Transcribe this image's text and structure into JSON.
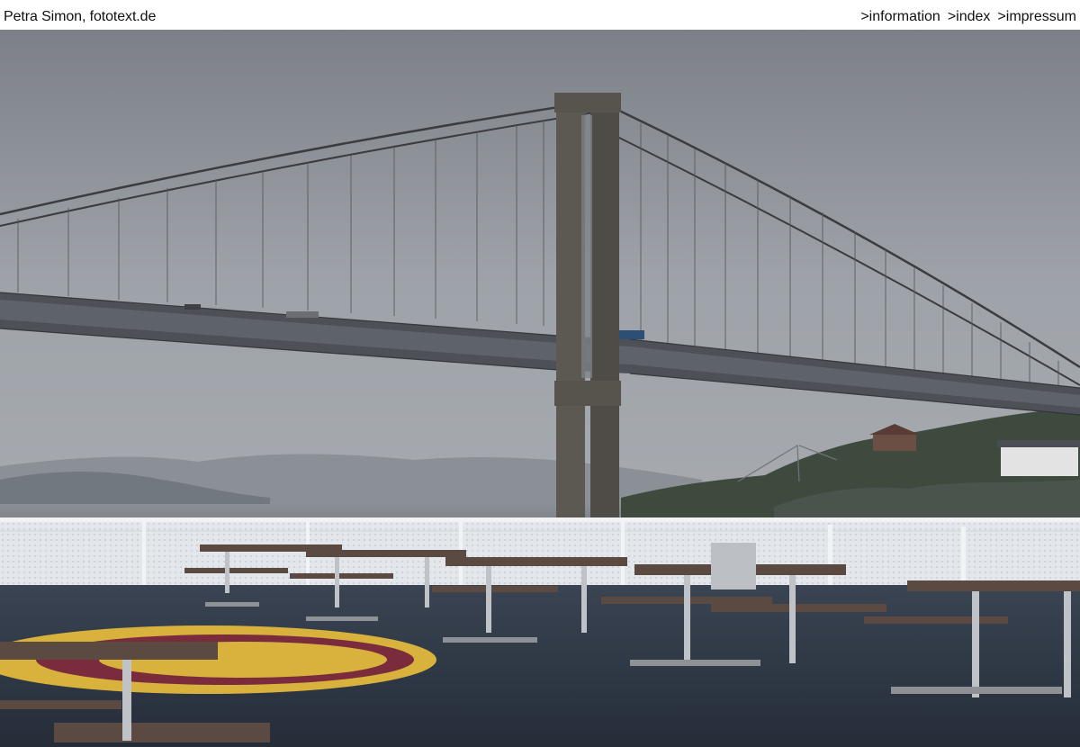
{
  "header": {
    "credit": "Petra Simon, fototext.de",
    "nav": [
      {
        "label": ">information"
      },
      {
        "label": ">index"
      },
      {
        "label": ">impressum"
      }
    ]
  },
  "colors": {
    "sky": "#8d9298",
    "water": "#6f757c",
    "tower": "#5a5650",
    "deck": "#2f3845",
    "helipad_yellow": "#d8b23c",
    "helipad_red": "#7a2c3c",
    "railing": "#e7e9ec"
  }
}
